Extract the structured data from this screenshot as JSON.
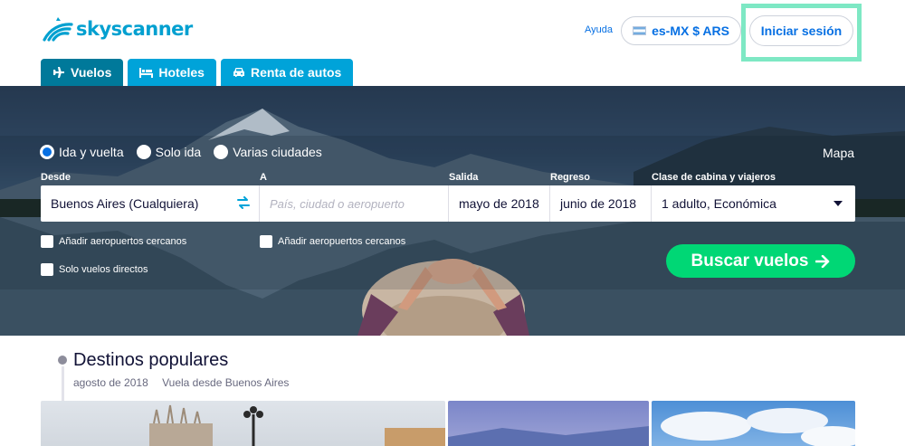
{
  "header": {
    "brand": "skyscanner",
    "help": "Ayuda",
    "locale": "es-MX $ ARS",
    "signin": "Iniciar sesión"
  },
  "tabs": [
    {
      "label": "Vuelos",
      "icon": "plane-icon",
      "active": true
    },
    {
      "label": "Hoteles",
      "icon": "bed-icon",
      "active": false
    },
    {
      "label": "Renta de autos",
      "icon": "car-icon",
      "active": false
    }
  ],
  "search": {
    "trip_types": [
      {
        "label": "Ida y vuelta",
        "checked": true
      },
      {
        "label": "Solo ida",
        "checked": false
      },
      {
        "label": "Varias ciudades",
        "checked": false
      }
    ],
    "map_link": "Mapa",
    "labels": {
      "from": "Desde",
      "to": "A",
      "depart": "Salida",
      "return": "Regreso",
      "cabin": "Clase de cabina y viajeros"
    },
    "from_value": "Buenos Aires (Cualquiera)",
    "to_placeholder": "País, ciudad o aeropuerto",
    "depart_value": "mayo de 2018",
    "return_value": "junio de 2018",
    "cabin_value": "1 adulto, Económica",
    "nearby_from": "Añadir aeropuertos cercanos",
    "nearby_to": "Añadir aeropuertos cercanos",
    "direct_only": "Solo vuelos directos",
    "submit": "Buscar vuelos"
  },
  "popular": {
    "title": "Destinos populares",
    "date": "agosto de 2018",
    "subtitle": "Vuela desde Buenos Aires"
  },
  "colors": {
    "brand": "#02a0d0",
    "link": "#0770e3",
    "tab": "#00a3d9",
    "tab_active": "#00799a",
    "cta": "#00d775",
    "highlight": "#7ee8c4"
  }
}
